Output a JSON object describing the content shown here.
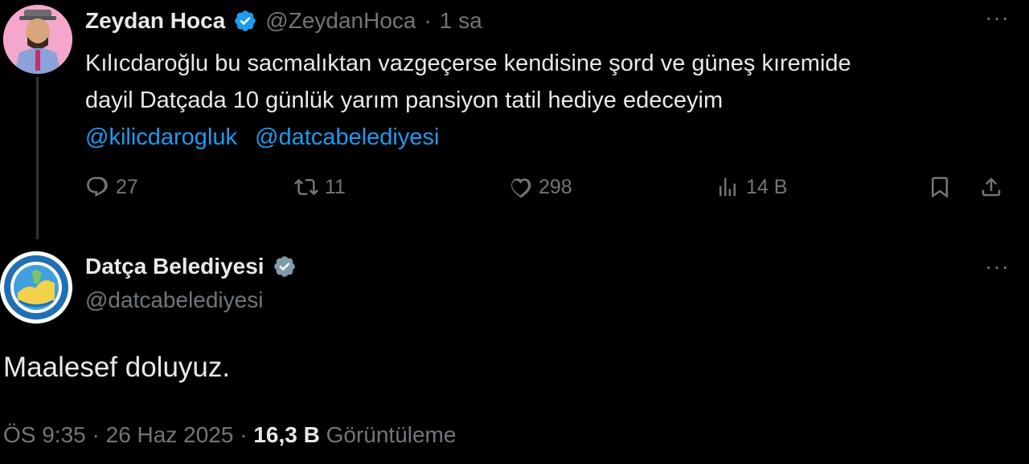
{
  "tweet": {
    "author_name": "Zeydan Hoca",
    "author_handle": "@ZeydanHoca",
    "separator": "·",
    "time": "1 sa",
    "more_label": "···",
    "text_line1": "Kılıcdaroğlu bu sacmalıktan  vazgeçerse  kendisine şord ve güneş kıremide",
    "text_line2": "dayil Datçada  10 günlük yarım pansiyon tatil hediye edeceyim",
    "mentions": [
      "@kilicdarogluk",
      "@datcabelediyesi"
    ],
    "replies": "27",
    "retweets": "11",
    "likes": "298",
    "views": "14 B"
  },
  "reply": {
    "author_name": "Datça Belediyesi",
    "author_handle": "@datcabelediyesi",
    "more_label": "···",
    "text": "Maalesef doluyuz.",
    "time": "ÖS 9:35",
    "date": "26 Haz 2025",
    "view_count": "16,3 B",
    "view_label": "Görüntüleme",
    "separator": "·"
  },
  "colors": {
    "background": "#000000",
    "text": "#e7e9ea",
    "muted": "#71767b",
    "link": "#1d9bf0",
    "verified_blue": "#1d9bf0",
    "verified_gray": "#829aab"
  },
  "icons": [
    "verified-badge-icon",
    "reply-icon",
    "retweet-icon",
    "like-icon",
    "views-icon",
    "bookmark-icon",
    "share-icon",
    "more-icon"
  ]
}
